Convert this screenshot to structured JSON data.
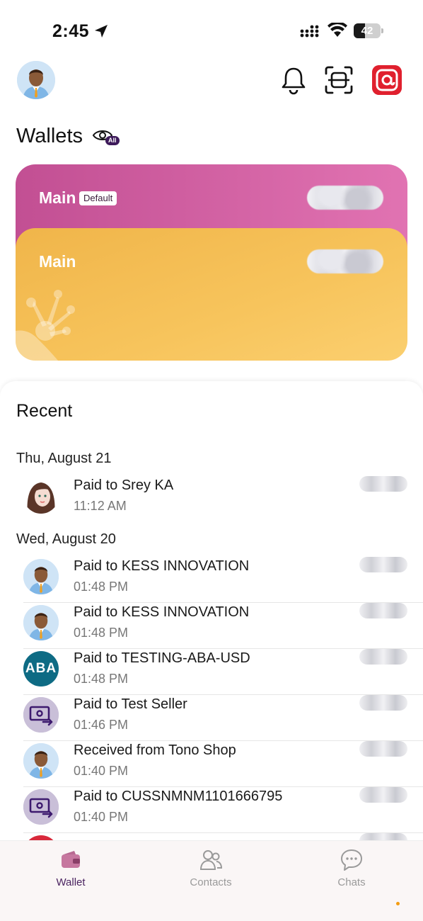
{
  "status_bar": {
    "time": "2:45",
    "battery": "42",
    "battery_level": 0.42
  },
  "header": {
    "avatar": "user-avatar",
    "icons": [
      "bell-icon",
      "scan-icon",
      "brand-icon"
    ]
  },
  "wallets": {
    "title": "Wallets",
    "visibility_badge": "All",
    "cards": [
      {
        "name": "Main",
        "badge": "Default",
        "color": "#d466a6"
      },
      {
        "name": "Main",
        "badge": "",
        "color": "#f5bf55"
      }
    ]
  },
  "recent": {
    "title": "Recent",
    "groups": [
      {
        "date": "Thu, August 21",
        "items": [
          {
            "title": "Paid to Srey KA",
            "time": "11:12 AM",
            "avatar": "woman"
          }
        ]
      },
      {
        "date": "Wed, August 20",
        "items": [
          {
            "title": "Paid to KESS INNOVATION",
            "time": "01:48 PM",
            "avatar": "person"
          },
          {
            "title": "Paid to KESS INNOVATION",
            "time": "01:48 PM",
            "avatar": "person"
          },
          {
            "title": "Paid to TESTING-ABA-USD",
            "time": "01:48 PM",
            "avatar": "aba",
            "avatar_text": "ABA"
          },
          {
            "title": "Paid to Test Seller",
            "time": "01:46 PM",
            "avatar": "seller"
          },
          {
            "title": "Received from Tono Shop",
            "time": "01:40 PM",
            "avatar": "person"
          },
          {
            "title": "Paid to CUSSNMNM1101666795",
            "time": "01:40 PM",
            "avatar": "seller"
          }
        ]
      }
    ]
  },
  "tabbar": {
    "tabs": [
      {
        "label": "Wallet",
        "active": true
      },
      {
        "label": "Contacts",
        "active": false
      },
      {
        "label": "Chats",
        "active": false
      }
    ]
  },
  "colors": {
    "accent": "#4a2360",
    "brand_red": "#e0202e",
    "aba_teal": "#0e6b84"
  }
}
